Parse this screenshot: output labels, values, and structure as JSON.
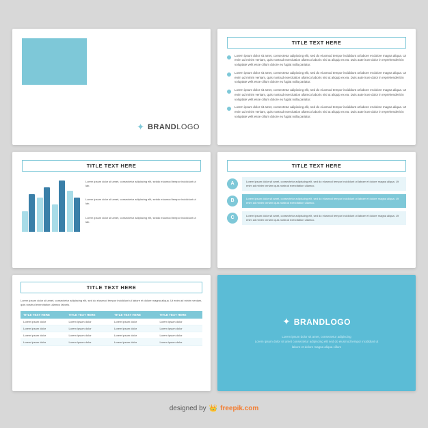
{
  "slides": [
    {
      "id": "slide-1",
      "type": "brand-logo",
      "brand_name": "BRAND",
      "brand_suffix": "LOGO",
      "logo_symbol": "✦"
    },
    {
      "id": "slide-2",
      "type": "bullets",
      "title": "TITLE TEXT HERE",
      "bullets": [
        "Lorem ipsum dolor sit amet, consectetur adipiscing elit, sed do eiusmod tempor incididunt ut labore et dolore magna aliqua. Ut enim ad minim veniam, quis nostrud exercitation ullamco laboris nisi ut aliquip ex ea. Duis aute irure dolor in reprehenderit in voluptate velit esse cillum dolore eu fugiat nulla pariatur.",
        "Lorem ipsum dolor sit amet, consectetur adipiscing elit, sed do eiusmod tempor incididunt ut labore et dolore magna aliqua. Ut enim ad minim veniam, quis nostrud exercitation ullamco laboris nisi ut aliquip ex ea. Duis aute irure dolor in reprehenderit in voluptate velit esse cillum dolore eu fugiat nulla pariatur.",
        "Lorem ipsum dolor sit amet, consectetur adipiscing elit, sed do eiusmod tempor incididunt ut labore et dolore magna aliqua. Ut enim ad minim veniam, quis nostrud exercitation ullamco laboris nisi ut aliquip ex ea. Duis aute irure dolor in reprehenderit in voluptate velit esse cillum dolore eu fugiat nulla pariatur.",
        "Lorem ipsum dolor sit amet, consectetur adipiscing elit, sed do eiusmod tempor incididunt ut labore et dolore magna aliqua. Ut enim ad minim veniam, quis nostrud exercitation ullamco laboris nisi ut aliquip ex ea. Duis aute irure dolor in reprehenderit in voluptate velit esse cillum dolore eu fugiat nulla pariatur."
      ]
    },
    {
      "id": "slide-3",
      "type": "bar-chart",
      "title": "TITLE TEXT HERE",
      "bars": [
        {
          "light": 30,
          "dark": 55
        },
        {
          "light": 50,
          "dark": 65
        },
        {
          "light": 40,
          "dark": 75
        },
        {
          "light": 60,
          "dark": 50
        }
      ],
      "text_items": [
        "Lorem ipsum dolor sit amet, consectetur adipiscing elit, seddo eiusmod tempor incididunt ut lab.",
        "Lorem ipsum dolor sit amet, consectetur adipiscing elit, seddo eiusmod tempor incididunt ut lab.",
        "Lorem ipsum dolor sit amet, consectetur adipiscing elit, seddo eiusmod tempor incididunt ut lab."
      ]
    },
    {
      "id": "slide-4",
      "type": "steps",
      "title": "TITLE TEXT HERE",
      "steps": [
        {
          "label": "A",
          "text": "Lorem ipsum dolor sit amet, consectetur adipiscing elit, sed do eiusmod tempor incididunt ut labore et dolore magna aliqua. Ut enim ad minim veniam quis nostrud exercitation ullamco.",
          "highlight": false
        },
        {
          "label": "B",
          "text": "Lorem ipsum dolor sit amet, consectetur adipiscing elit, sed do eiusmod tempor incididunt ut labore et dolore magna aliqua. Ut enim ad minim veniam quis nostrud exercitation ullamco.",
          "highlight": true
        },
        {
          "label": "C",
          "text": "Lorem ipsum dolor sit amet, consectetur adipiscing elit, sed do eiusmod tempor incididunt ut labore et dolore magna aliqua. Ut enim ad minim veniam quis nostrud exercitation ullamco.",
          "highlight": false
        }
      ]
    },
    {
      "id": "slide-5",
      "type": "table",
      "title": "TITLE TEXT HERE",
      "intro": "Lorem ipsum dolor sit amet, consectetur adipiscing elit, sed do eiusmod tempor incididunt ut labore et dolore magna aliqua. Ut enim ad minim veniam, quis nostrud exercitation ullamco laboris.",
      "columns": [
        "TITLE TEXT HERE",
        "TITLE TEXT HERE",
        "TITLE TEXT HERE",
        "TITLE TEXT HERE"
      ],
      "rows": [
        [
          "Lorem ipsum dolor",
          "Lorem ipsum dolor",
          "Lorem ipsum dolor",
          "Lorem ipsum dolor"
        ],
        [
          "Lorem ipsum dolor",
          "Lorem ipsum dolor",
          "Lorem ipsum dolor",
          "Lorem ipsum dolor"
        ],
        [
          "Lorem ipsum dolor",
          "Lorem ipsum dolor",
          "Lorem ipsum dolor",
          "Lorem ipsum dolor"
        ],
        [
          "Lorem ipsum dolor",
          "Lorem ipsum dolor",
          "Lorem ipsum dolor",
          "Lorem ipsum dolor"
        ]
      ]
    },
    {
      "id": "slide-6",
      "type": "brand-blue",
      "brand_name": "BRAND",
      "brand_suffix": "LOGO",
      "logo_symbol": "✦",
      "sub_text": "Lorem ipsum dolor sit amet, consectetur adipiscing\nLorem ipsum dolor sit amet, consectetur adipiscing elit sed do eiusmod tempor incididunt ut\nlabore et dolore magna aliqua cillum"
    }
  ],
  "footer": {
    "designed_by": "designed by",
    "brand": "freepik.com"
  }
}
